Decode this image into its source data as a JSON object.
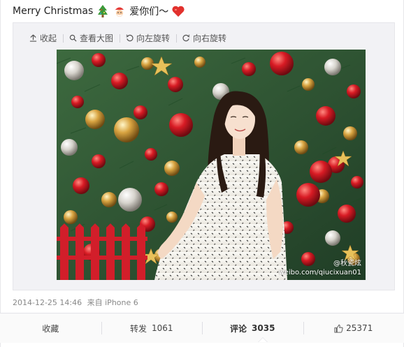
{
  "post": {
    "text": "Merry Christmas",
    "text_suffix": "爱你们～",
    "emojis": [
      "christmas-tree-icon",
      "santa-icon",
      "heart-icon"
    ]
  },
  "media_toolbar": {
    "collapse": "收起",
    "view_large": "查看大图",
    "rotate_left": "向左旋转",
    "rotate_right": "向右旋转"
  },
  "photo": {
    "watermark_handle": "@秋瓷炫",
    "watermark_url": "weibo.com/qiucixuan01"
  },
  "meta": {
    "timestamp": "2014-12-25 14:46",
    "source_prefix": "来自",
    "device": "iPhone 6"
  },
  "actions": {
    "favorite_label": "收藏",
    "repost_label": "转发",
    "repost_count": "1061",
    "comment_label": "评论",
    "comment_count": "3035",
    "like_count": "25371"
  },
  "colors": {
    "accent_red": "#e2312d",
    "text": "#333333",
    "meta": "#888888",
    "panel_bg": "#f2f2f5"
  }
}
